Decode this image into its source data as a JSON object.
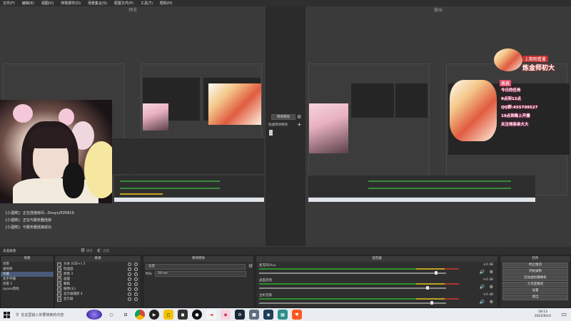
{
  "menu": [
    "文件(F)",
    "编辑(E)",
    "视图(V)",
    "停靠部件(D)",
    "场景集合(S)",
    "配置文件(P)",
    "工具(T)",
    "帮助(H)"
  ],
  "preview_label": "预览",
  "program_label": "输出",
  "log_lines": [
    "[小酒窝]：正在连接房间...Douyu/505819",
    "[小酒窝]：正在与服务器连接",
    "[小酒窝]：与服务器连接成功"
  ],
  "transition": {
    "label": "转场特效",
    "fade_label": "快速转场特效",
    "studio_button": "转场特效"
  },
  "status": {
    "left": "未选择源",
    "properties": "属性",
    "filters": "滤镜"
  },
  "scenes": {
    "title": "场景",
    "items": [
      "场景",
      "虚拟机",
      "抗翼",
      "女手开播",
      "场景 2",
      "ayooo游戏"
    ],
    "selected": 2
  },
  "sources": {
    "title": "来源",
    "items": [
      {
        "icon": "T",
        "label": "文本 (GDI+) 3"
      },
      {
        "icon": "▭",
        "label": "粒固固"
      },
      {
        "icon": "▭",
        "label": "图像 3"
      },
      {
        "icon": "T",
        "label": "画面"
      },
      {
        "icon": "▭",
        "label": "聚稿"
      },
      {
        "icon": "▭",
        "label": "摄像(头)"
      },
      {
        "icon": "▭",
        "label": "显示器捕获 4"
      },
      {
        "icon": "▭",
        "label": "显示器"
      }
    ]
  },
  "transitions_dock": {
    "title": "转场特效",
    "type": "淡变",
    "duration_label": "时长",
    "duration_value": "50 ms"
  },
  "mixer": {
    "title": "混音器",
    "tracks": [
      {
        "name": "麦克风/Aux",
        "db": "-inf dB"
      },
      {
        "name": "桌面音频",
        "db": "-inf dB"
      },
      {
        "name": "主机音频",
        "db": "-inf dB"
      }
    ]
  },
  "controls": {
    "title": "控件",
    "buttons": [
      "停止推流",
      "开始录制",
      "启动虚拟摄像机",
      "工作室模式",
      "设置",
      "退出"
    ]
  },
  "taskbar": {
    "search_placeholder": "在这里输入你要搜索的内容",
    "time": "18:13",
    "date": "2022/8/14"
  },
  "overlay_text": {
    "banner": "上期观看量",
    "name": "炼金师初大",
    "tag": "酱酱",
    "lines": [
      "今日的任务",
      "9点到12点",
      "QQ群:455709527",
      "19点到晚上开播",
      "关注领亲亲大大"
    ]
  },
  "colors": {
    "accent_selection": "#4a5a78",
    "meter_green": "#2f8f2f",
    "meter_yellow": "#b9a21f",
    "meter_red": "#aa3333"
  }
}
